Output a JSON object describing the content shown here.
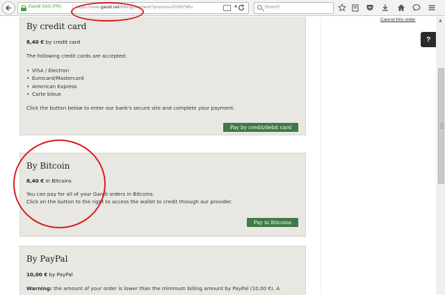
{
  "browser": {
    "site_identity": "Gandi SAS (FR)",
    "url_prefix": "https://www.",
    "url_domain": "gandi.net",
    "url_rest": "/billing/payment?process=ZG9tYWlu",
    "search_placeholder": "Search",
    "icons": {
      "back": "back-arrow-icon",
      "lock": "lock-icon",
      "reader": "reader-view-icon",
      "dropdown": "dropdown-icon",
      "reload": "reload-icon",
      "star": "bookmark-star-icon",
      "library": "bookmarks-library-icon",
      "pocket": "pocket-icon",
      "download": "download-icon",
      "home": "home-icon",
      "chat": "chat-icon",
      "menu": "hamburger-menu-icon"
    }
  },
  "page": {
    "cancel_link": "Cancel this order",
    "help_label": "?"
  },
  "credit_card": {
    "title": "By credit card",
    "price": "8,40 €",
    "price_suffix": " by credit card",
    "intro": "The following credit cards are accepted:",
    "cards": [
      "VISA / Electron",
      "Eurocard/Mastercard",
      "American Express",
      "Carte bleue"
    ],
    "instruction": "Click the button below to enter our bank's secure site and complete your payment.",
    "button": "Pay by credit/debit card"
  },
  "bitcoin": {
    "title": "By Bitcoin",
    "price": "8,40 €",
    "price_suffix": " in Bitcoins",
    "line1": "You can pay for all of your Gandi orders in Bitcoins.",
    "line2": "Click on the button to the right to access the wallet to credit through our provider.",
    "button": "Pay in Bitcoins"
  },
  "paypal": {
    "title": "By PayPal",
    "price": "10,00 €",
    "price_suffix": " by PayPal",
    "warning_label": "Warning:",
    "warning_text": " the amount of your order is lower than the minimum billing amount by PayPal (10,00 €). A"
  },
  "colors": {
    "button_green": "#3f7a47",
    "card_bg": "#e8e7e2",
    "annotation_red": "#d61a1a",
    "secure_green": "#3fa33a"
  }
}
